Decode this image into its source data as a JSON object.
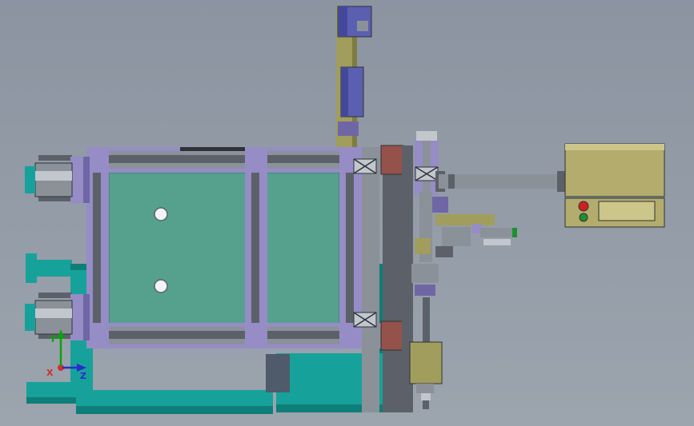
{
  "viewport": {
    "triad": {
      "x_label": "X",
      "y_label": "Y",
      "z_label": "Z"
    }
  },
  "colors": {
    "bg-top": "#8b94a0",
    "bg-bottom": "#9ca4ae",
    "teal": "#16a29a",
    "teal-dark": "#0e7e78",
    "plate-green": "#55a18d",
    "plate-green-dark": "#3c8270",
    "lavender": "#968cc6",
    "lavender-dark": "#6f66a6",
    "part-gray": "#8b9199",
    "part-gray-dark": "#5c6169",
    "part-gray-light": "#c2c7cd",
    "khaki": "#a19d5c",
    "khaki-light": "#b3ac6c",
    "khaki-pale": "#cdc68a",
    "olive": "#7f7c42",
    "red-brown": "#94524a",
    "blue-block": "#5a5fb2",
    "blue-block-dark": "#44489a",
    "button-red": "#cf2020",
    "button-green": "#1f8f2f",
    "hole-white": "#f2f4f5",
    "slate": "#4f5a6b",
    "outline-dark": "#2e3238",
    "axis-x": "#d03030",
    "axis-y": "#0fa00f",
    "axis-z": "#2a2ad0"
  }
}
